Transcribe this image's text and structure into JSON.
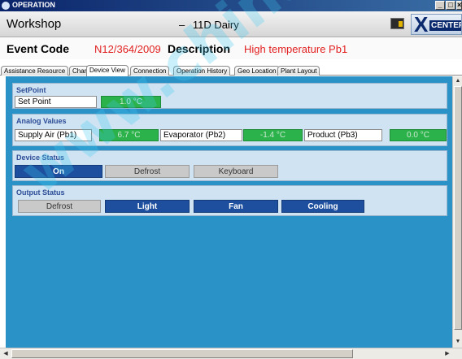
{
  "window": {
    "title": "OPERATION",
    "controls": {
      "minimize": "_",
      "restore": "□",
      "close": "×"
    }
  },
  "header": {
    "workshop": "Workshop",
    "dash": "–",
    "unit": "11D Dairy",
    "logo_text": "CENTER",
    "logo_letter": "X",
    "event_code_label": "Event Code",
    "event_code_value": "N12/364/2009",
    "description_label": "Description",
    "description_value": "High temperature Pb1"
  },
  "tabs": [
    {
      "label": "Assistance Resource"
    },
    {
      "label": "Chart"
    },
    {
      "label": "Device View",
      "active": true
    },
    {
      "label": "Connection"
    },
    {
      "label": "Operation History"
    },
    {
      "label": "Geo Location"
    },
    {
      "label": "Plant Layout"
    }
  ],
  "setpoint": {
    "title": "SetPoint",
    "label": "Set Point",
    "value": "1.0 °C"
  },
  "analog": {
    "title": "Analog Values",
    "items": [
      {
        "label": "Supply Air (Pb1)",
        "value": "6.7 °C"
      },
      {
        "label": "Evaporator (Pb2)",
        "value": "-1.4 °C"
      },
      {
        "label": "Product (Pb3)",
        "value": "0.0 °C"
      }
    ]
  },
  "device_status": {
    "title": "Device Status",
    "items": [
      {
        "label": "On",
        "active": true
      },
      {
        "label": "Defrost",
        "active": false
      },
      {
        "label": "Keyboard",
        "active": false
      }
    ]
  },
  "output_status": {
    "title": "Output Status",
    "items": [
      {
        "label": "Defrost",
        "active": false
      },
      {
        "label": "Light",
        "active": true
      },
      {
        "label": "Fan",
        "active": true
      },
      {
        "label": "Cooling",
        "active": true
      }
    ]
  },
  "colors": {
    "main_bg": "#2b92c8",
    "value_green": "#2cb24b",
    "status_active": "#1d4f9e",
    "alert_red": "#e21f1f"
  },
  "icons": {
    "app": "app-icon",
    "exit": "exit-door-icon",
    "logo": "xcenter-logo"
  },
  "watermark": "www.chinaz.com"
}
